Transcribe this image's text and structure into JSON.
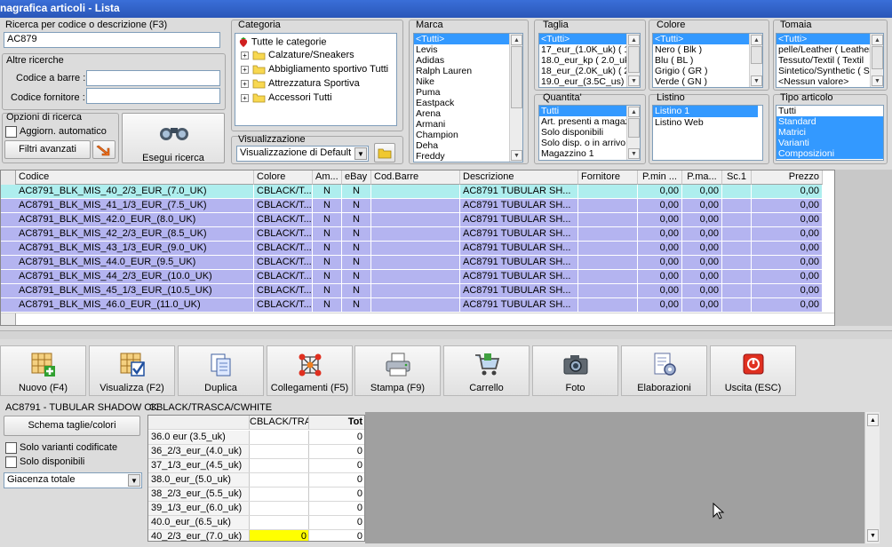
{
  "window": {
    "title": "nagrafica articoli  - Lista"
  },
  "search": {
    "label": "Ricerca per codice o descrizione (F3)",
    "value": "AC879"
  },
  "other": {
    "title": "Altre ricerche",
    "barcode_label": "Codice a barre :",
    "barcode_value": "",
    "supplier_label": "Codice fornitore :",
    "supplier_value": ""
  },
  "options": {
    "title": "Opzioni di ricerca",
    "auto_label": "Aggiorn. automatico",
    "advanced_label": "Filtri avanzati",
    "search_btn": "Esegui ricerca"
  },
  "category": {
    "title": "Categoria",
    "root": "Tutte le categorie",
    "items": [
      "Calzature/Sneakers",
      "Abbigliamento sportivo Tutti",
      "Attrezzatura Sportiva",
      "Accessori Tutti"
    ]
  },
  "view": {
    "title": "Visualizzazione",
    "value": "Visualizzazione di Default"
  },
  "brand": {
    "title": "Marca",
    "items": [
      "<Tutti>",
      "Levis",
      "Adidas",
      "Ralph Lauren",
      "Nike",
      "Puma",
      "Eastpack",
      "Arena",
      "Armani",
      "Champion",
      "Deha",
      "Freddy"
    ]
  },
  "sizes": {
    "title": "Taglia",
    "items": [
      "<Tutti>",
      "17_eur_(1.0K_uk) ( 1",
      "18.0_eur_kp ( 2.0_uk",
      "18_eur_(2.0K_uk) ( 2",
      "19.0_eur_(3.5C_us) ("
    ]
  },
  "colors": {
    "title": "Colore",
    "items": [
      "<Tutti>",
      "Nero ( Blk )",
      "Blu ( BL )",
      "Grigio ( GR )",
      "Verde ( GN )"
    ]
  },
  "upper": {
    "title": "Tomaia",
    "items": [
      "<Tutti>",
      "pelle/Leather ( Leather",
      "Tessuto/Textil ( Textil",
      "Sintetico/Synthetic ( S",
      "<Nessun valore>"
    ]
  },
  "qty": {
    "title": "Quantita'",
    "items": [
      "Tutti",
      "Art. presenti a magaz",
      "Solo disponibili",
      "Solo disp. o in arrivo",
      "Magazzino 1"
    ]
  },
  "pricelist": {
    "title": "Listino",
    "items": [
      "Listino 1",
      "Listino Web"
    ]
  },
  "type": {
    "title": "Tipo articolo",
    "items": [
      "Tutti",
      "Standard",
      "Matrici",
      "Varianti",
      "Composizioni"
    ]
  },
  "grid": {
    "headers": [
      "Codice",
      "Colore",
      "Am...",
      "eBay",
      "Cod.Barre",
      "Descrizione",
      "Fornitore",
      "P.min ...",
      "P.ma...",
      "Sc.1",
      "Prezzo"
    ],
    "rows": [
      [
        "AC8791_BLK_MIS_40_2/3_EUR_(7.0_UK)",
        "CBLACK/T...",
        "N",
        "N",
        "",
        "AC8791   TUBULAR SH...",
        "",
        "0,00",
        "0,00",
        "",
        "0,00"
      ],
      [
        "AC8791_BLK_MIS_41_1/3_EUR_(7.5_UK)",
        "CBLACK/T...",
        "N",
        "N",
        "",
        "AC8791   TUBULAR SH...",
        "",
        "0,00",
        "0,00",
        "",
        "0,00"
      ],
      [
        "AC8791_BLK_MIS_42.0_EUR_(8.0_UK)",
        "CBLACK/T...",
        "N",
        "N",
        "",
        "AC8791   TUBULAR SH...",
        "",
        "0,00",
        "0,00",
        "",
        "0,00"
      ],
      [
        "AC8791_BLK_MIS_42_2/3_EUR_(8.5_UK)",
        "CBLACK/T...",
        "N",
        "N",
        "",
        "AC8791   TUBULAR SH...",
        "",
        "0,00",
        "0,00",
        "",
        "0,00"
      ],
      [
        "AC8791_BLK_MIS_43_1/3_EUR_(9.0_UK)",
        "CBLACK/T...",
        "N",
        "N",
        "",
        "AC8791   TUBULAR SH...",
        "",
        "0,00",
        "0,00",
        "",
        "0,00"
      ],
      [
        "AC8791_BLK_MIS_44.0_EUR_(9.5_UK)",
        "CBLACK/T...",
        "N",
        "N",
        "",
        "AC8791   TUBULAR SH...",
        "",
        "0,00",
        "0,00",
        "",
        "0,00"
      ],
      [
        "AC8791_BLK_MIS_44_2/3_EUR_(10.0_UK)",
        "CBLACK/T...",
        "N",
        "N",
        "",
        "AC8791   TUBULAR SH...",
        "",
        "0,00",
        "0,00",
        "",
        "0,00"
      ],
      [
        "AC8791_BLK_MIS_45_1/3_EUR_(10.5_UK)",
        "CBLACK/T...",
        "N",
        "N",
        "",
        "AC8791   TUBULAR SH...",
        "",
        "0,00",
        "0,00",
        "",
        "0,00"
      ],
      [
        "AC8791_BLK_MIS_46.0_EUR_(11.0_UK)",
        "CBLACK/T...",
        "N",
        "N",
        "",
        "AC8791   TUBULAR SH...",
        "",
        "0,00",
        "0,00",
        "",
        "0,00"
      ]
    ]
  },
  "toolbar": [
    {
      "label": "Nuovo (F4)",
      "icon": "new-grid-icon"
    },
    {
      "label": "Visualizza (F2)",
      "icon": "view-grid-icon"
    },
    {
      "label": "Duplica",
      "icon": "duplicate-icon"
    },
    {
      "label": "Collegamenti (F5)",
      "icon": "links-icon"
    },
    {
      "label": "Stampa (F9)",
      "icon": "printer-icon"
    },
    {
      "label": "Carrello",
      "icon": "cart-icon"
    },
    {
      "label": "Foto",
      "icon": "camera-icon"
    },
    {
      "label": "Elaborazioni",
      "icon": "processing-icon"
    },
    {
      "label": "Uscita (ESC)",
      "icon": "exit-icon"
    }
  ],
  "detail": {
    "article": "AC8791 - TUBULAR SHADOW CK",
    "schema_btn": "Schema taglie/colori",
    "only_coded": "Solo varianti codificate",
    "only_available": "Solo disponibili",
    "stock_select": "Giacenza totale",
    "color_header": "CBLACK/TRASCA/CWHITE",
    "col_color": "CBLACK/TRA",
    "col_tot": "Tot",
    "rows": [
      [
        "36.0 eur (3.5_uk)",
        "",
        "0"
      ],
      [
        "36_2/3_eur_(4.0_uk)",
        "",
        "0"
      ],
      [
        "37_1/3_eur_(4.5_uk)",
        "",
        "0"
      ],
      [
        "38.0_eur_(5.0_uk)",
        "",
        "0"
      ],
      [
        "38_2/3_eur_(5.5_uk)",
        "",
        "0"
      ],
      [
        "39_1/3_eur_(6.0_uk)",
        "",
        "0"
      ],
      [
        "40.0_eur_(6.5_uk)",
        "",
        "0"
      ],
      [
        "40_2/3_eur_(7.0_uk)",
        "0",
        "0"
      ]
    ]
  },
  "colors_ui": {
    "row_selected": "#aeeeee",
    "row_normal": "#b4b4f0",
    "highlight_cell": "#ffff00"
  }
}
